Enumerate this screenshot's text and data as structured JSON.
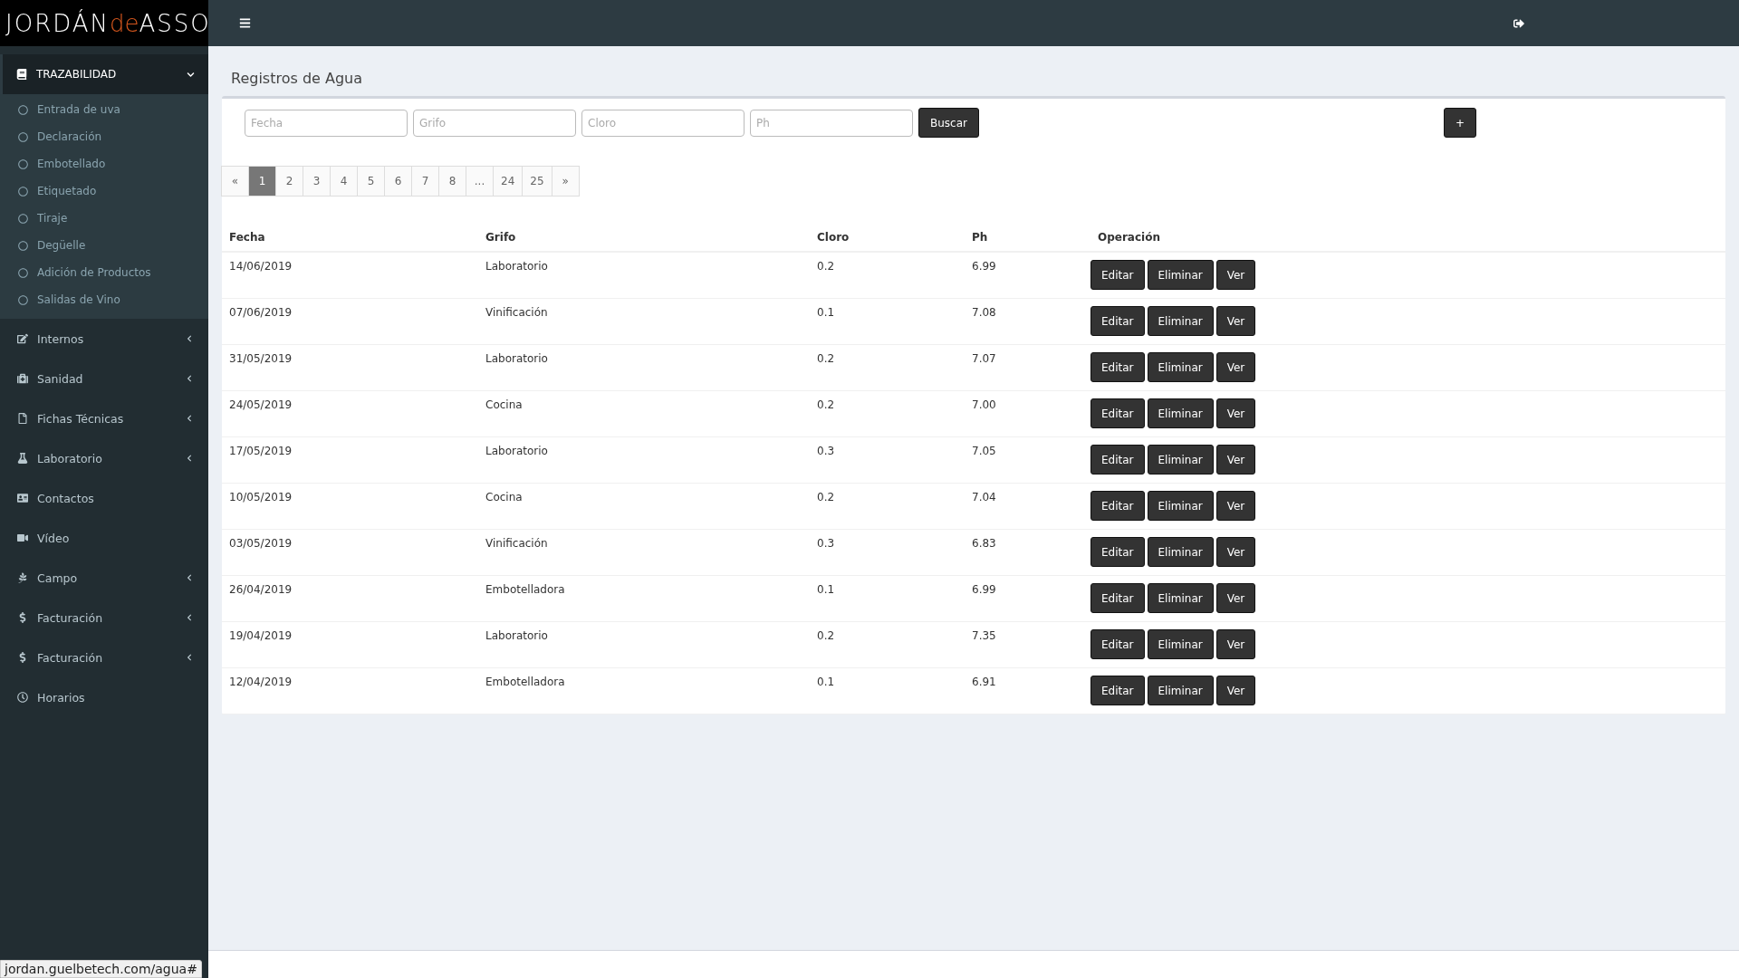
{
  "logo": [
    {
      "text": "JORDÁN",
      "accent": false
    },
    {
      "text": "de",
      "accent": true
    },
    {
      "text": "ASSO",
      "accent": false
    }
  ],
  "sidebar": {
    "section": {
      "label": "TRAZABILIDAD",
      "expanded": true,
      "children": [
        {
          "label": "Entrada de uva"
        },
        {
          "label": "Declaración"
        },
        {
          "label": "Embotellado"
        },
        {
          "label": "Etiquetado"
        },
        {
          "label": "Tiraje"
        },
        {
          "label": "Degüelle"
        },
        {
          "label": "Adición de Productos"
        },
        {
          "label": "Salidas de Vino"
        }
      ]
    },
    "items": [
      {
        "label": "Internos",
        "expandable": true
      },
      {
        "label": "Sanidad",
        "expandable": true
      },
      {
        "label": "Fichas Técnicas",
        "expandable": true
      },
      {
        "label": "Laboratorio",
        "expandable": true
      },
      {
        "label": "Contactos",
        "expandable": false
      },
      {
        "label": "Vídeo",
        "expandable": false
      },
      {
        "label": "Campo",
        "expandable": true
      },
      {
        "label": "Facturación",
        "expandable": true
      },
      {
        "label": "Facturación",
        "expandable": true
      },
      {
        "label": "Horarios",
        "expandable": false
      }
    ]
  },
  "page_title": "Registros de Agua",
  "filters": {
    "fields": [
      {
        "placeholder": "Fecha"
      },
      {
        "placeholder": "Grifo"
      },
      {
        "placeholder": "Cloro"
      },
      {
        "placeholder": "Ph"
      }
    ],
    "search_button": "Buscar",
    "add_button": "+"
  },
  "pagination": [
    {
      "label": "«",
      "selected": false
    },
    {
      "label": "1",
      "selected": true
    },
    {
      "label": "2",
      "selected": false
    },
    {
      "label": "3",
      "selected": false
    },
    {
      "label": "4",
      "selected": false
    },
    {
      "label": "5",
      "selected": false
    },
    {
      "label": "6",
      "selected": false
    },
    {
      "label": "7",
      "selected": false
    },
    {
      "label": "8",
      "selected": false
    },
    {
      "label": "...",
      "selected": false
    },
    {
      "label": "24",
      "selected": false
    },
    {
      "label": "25",
      "selected": false
    },
    {
      "label": "»",
      "selected": false
    }
  ],
  "table": {
    "columns": [
      "Fecha",
      "Grifo",
      "Cloro",
      "Ph",
      "Operación"
    ],
    "rows": [
      {
        "cells": [
          "14/06/2019",
          "Laboratorio",
          "0.2",
          "6.99"
        ],
        "actions": [
          "Editar",
          "Eliminar",
          "Ver"
        ]
      },
      {
        "cells": [
          "07/06/2019",
          "Vinificación",
          "0.1",
          "7.08"
        ],
        "actions": [
          "Editar",
          "Eliminar",
          "Ver"
        ]
      },
      {
        "cells": [
          "31/05/2019",
          "Laboratorio",
          "0.2",
          "7.07"
        ],
        "actions": [
          "Editar",
          "Eliminar",
          "Ver"
        ]
      },
      {
        "cells": [
          "24/05/2019",
          "Cocina",
          "0.2",
          "7.00"
        ],
        "actions": [
          "Editar",
          "Eliminar",
          "Ver"
        ]
      },
      {
        "cells": [
          "17/05/2019",
          "Laboratorio",
          "0.3",
          "7.05"
        ],
        "actions": [
          "Editar",
          "Eliminar",
          "Ver"
        ]
      },
      {
        "cells": [
          "10/05/2019",
          "Cocina",
          "0.2",
          "7.04"
        ],
        "actions": [
          "Editar",
          "Eliminar",
          "Ver"
        ]
      },
      {
        "cells": [
          "03/05/2019",
          "Vinificación",
          "0.3",
          "6.83"
        ],
        "actions": [
          "Editar",
          "Eliminar",
          "Ver"
        ]
      },
      {
        "cells": [
          "26/04/2019",
          "Embotelladora",
          "0.1",
          "6.99"
        ],
        "actions": [
          "Editar",
          "Eliminar",
          "Ver"
        ]
      },
      {
        "cells": [
          "19/04/2019",
          "Laboratorio",
          "0.2",
          "7.35"
        ],
        "actions": [
          "Editar",
          "Eliminar",
          "Ver"
        ]
      },
      {
        "cells": [
          "12/04/2019",
          "Embotelladora",
          "0.1",
          "6.91"
        ],
        "actions": [
          "Editar",
          "Eliminar",
          "Ver"
        ]
      }
    ]
  },
  "status_bar": {
    "url": "jordan.guelbetech.com/agua#"
  }
}
